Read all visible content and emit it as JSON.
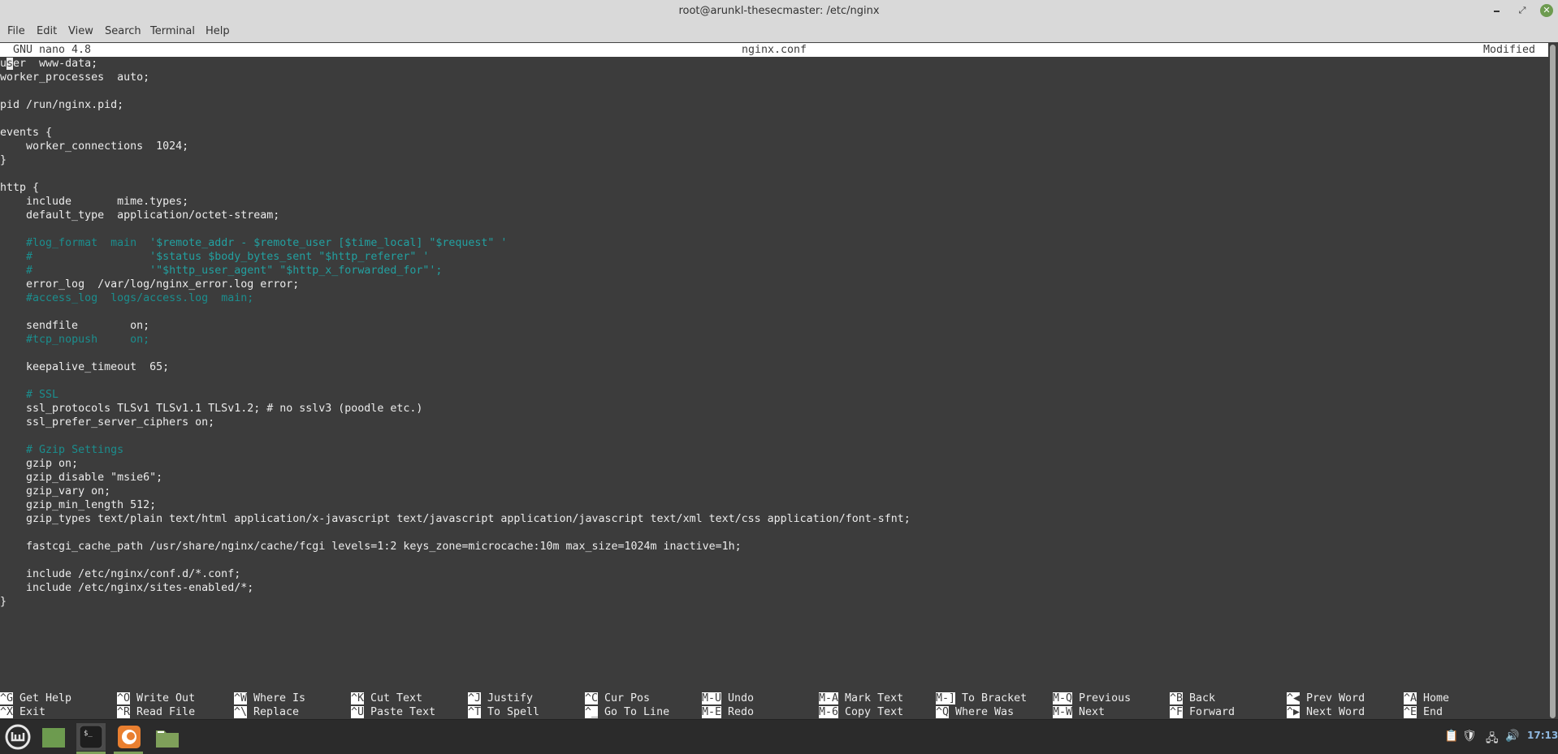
{
  "window": {
    "title": "root@arunkl-thesecmaster: /etc/nginx",
    "minimize_label": "",
    "maximize_label": "⤢",
    "close_label": "✕"
  },
  "menu": [
    "File",
    "Edit",
    "View",
    "Search",
    "Terminal",
    "Help"
  ],
  "nano": {
    "version": "GNU nano 4.8",
    "filename": "nginx.conf",
    "status": "Modified"
  },
  "editor": {
    "cursor_line": 1,
    "cursor_col": 2,
    "lines": [
      [
        [
          "t",
          "user  www-data;"
        ]
      ],
      [
        [
          "t",
          "worker_processes  auto;"
        ]
      ],
      [],
      [
        [
          "t",
          "pid /run/nginx.pid;"
        ]
      ],
      [],
      [
        [
          "t",
          "events {"
        ]
      ],
      [
        [
          "t",
          "    worker_connections  1024;"
        ]
      ],
      [
        [
          "t",
          "}"
        ]
      ],
      [],
      [
        [
          "t",
          "http {"
        ]
      ],
      [
        [
          "t",
          "    include       mime.types;"
        ]
      ],
      [
        [
          "t",
          "    default_type  application/octet-stream;"
        ]
      ],
      [],
      [
        [
          "t",
          "    "
        ],
        [
          "c",
          "#log_format  main  "
        ],
        [
          "s",
          "'$remote_addr - $remote_user [$time_local] \"$request\" '"
        ]
      ],
      [
        [
          "t",
          "    "
        ],
        [
          "c",
          "#                  "
        ],
        [
          "s",
          "'$status $body_bytes_sent \"$http_referer\" '"
        ]
      ],
      [
        [
          "t",
          "    "
        ],
        [
          "c",
          "#                  "
        ],
        [
          "s",
          "'\"$http_user_agent\" \"$http_x_forwarded_for\"';"
        ]
      ],
      [
        [
          "t",
          "    error_log  /var/log/nginx_error.log error;"
        ]
      ],
      [
        [
          "t",
          "    "
        ],
        [
          "c",
          "#access_log  logs/access.log  main;"
        ]
      ],
      [],
      [
        [
          "t",
          "    sendfile        on;"
        ]
      ],
      [
        [
          "t",
          "    "
        ],
        [
          "c",
          "#tcp_nopush     on;"
        ]
      ],
      [],
      [
        [
          "t",
          "    keepalive_timeout  65;"
        ]
      ],
      [],
      [
        [
          "t",
          "    "
        ],
        [
          "c",
          "# SSL"
        ]
      ],
      [
        [
          "t",
          "    ssl_protocols TLSv1 TLSv1.1 TLSv1.2; # no sslv3 (poodle etc.)"
        ]
      ],
      [
        [
          "t",
          "    ssl_prefer_server_ciphers on;"
        ]
      ],
      [],
      [
        [
          "t",
          "    "
        ],
        [
          "c",
          "# Gzip Settings"
        ]
      ],
      [
        [
          "t",
          "    gzip on;"
        ]
      ],
      [
        [
          "t",
          "    gzip_disable \"msie6\";"
        ]
      ],
      [
        [
          "t",
          "    gzip_vary on;"
        ]
      ],
      [
        [
          "t",
          "    gzip_min_length 512;"
        ]
      ],
      [
        [
          "t",
          "    gzip_types text/plain text/html application/x-javascript text/javascript application/javascript text/xml text/css application/font-sfnt;"
        ]
      ],
      [],
      [
        [
          "t",
          "    fastcgi_cache_path /usr/share/nginx/cache/fcgi levels=1:2 keys_zone=microcache:10m max_size=1024m inactive=1h;"
        ]
      ],
      [],
      [
        [
          "t",
          "    include /etc/nginx/conf.d/*.conf;"
        ]
      ],
      [
        [
          "t",
          "    include /etc/nginx/sites-enabled/*;"
        ]
      ],
      [
        [
          "t",
          "}"
        ]
      ]
    ]
  },
  "shortcuts": [
    [
      {
        "key": "^G",
        "label": "Get Help"
      },
      {
        "key": "^X",
        "label": "Exit"
      }
    ],
    [
      {
        "key": "^O",
        "label": "Write Out"
      },
      {
        "key": "^R",
        "label": "Read File"
      }
    ],
    [
      {
        "key": "^W",
        "label": "Where Is"
      },
      {
        "key": "^\\",
        "label": "Replace"
      }
    ],
    [
      {
        "key": "^K",
        "label": "Cut Text"
      },
      {
        "key": "^U",
        "label": "Paste Text"
      }
    ],
    [
      {
        "key": "^J",
        "label": "Justify"
      },
      {
        "key": "^T",
        "label": "To Spell"
      }
    ],
    [
      {
        "key": "^C",
        "label": "Cur Pos"
      },
      {
        "key": "^_",
        "label": "Go To Line"
      }
    ],
    [
      {
        "key": "M-U",
        "label": "Undo"
      },
      {
        "key": "M-E",
        "label": "Redo"
      }
    ],
    [
      {
        "key": "M-A",
        "label": "Mark Text"
      },
      {
        "key": "M-6",
        "label": "Copy Text"
      }
    ],
    [
      {
        "key": "M-]",
        "label": "To Bracket"
      },
      {
        "key": "^Q",
        "label": "Where Was"
      }
    ],
    [
      {
        "key": "M-Q",
        "label": "Previous"
      },
      {
        "key": "M-W",
        "label": "Next"
      }
    ],
    [
      {
        "key": "^B",
        "label": "Back"
      },
      {
        "key": "^F",
        "label": "Forward"
      }
    ],
    [
      {
        "key": "^◀",
        "label": "Prev Word"
      },
      {
        "key": "^▶",
        "label": "Next Word"
      }
    ],
    [
      {
        "key": "^A",
        "label": "Home"
      },
      {
        "key": "^E",
        "label": "End"
      }
    ]
  ],
  "taskbar": {
    "apps": [
      "mint-menu-icon",
      "show-desktop-icon",
      "terminal-icon",
      "firefox-icon",
      "files-icon"
    ],
    "tray": [
      "clipboard-icon",
      "shield-icon",
      "network-icon",
      "volume-icon"
    ],
    "clock": "17:13"
  },
  "colors": {
    "background": "#3c3c3c",
    "text": "#ececec",
    "comment": "#1b8e8e",
    "accent": "#7fa05a"
  }
}
